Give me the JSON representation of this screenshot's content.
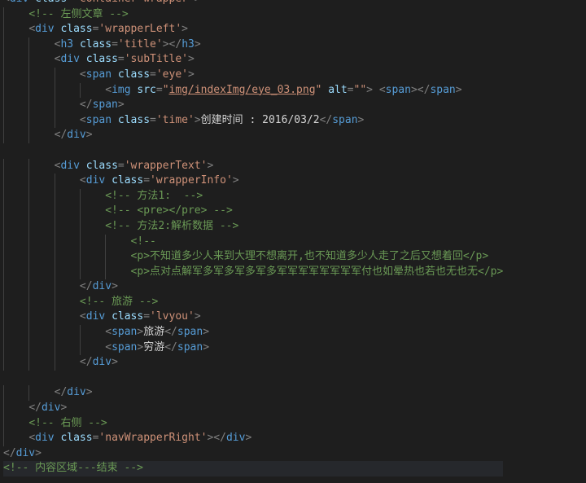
{
  "lines": [
    {
      "indent": 0,
      "tokens": [
        [
          "punct",
          "<"
        ],
        [
          "tag",
          "div"
        ],
        [
          "text",
          " "
        ],
        [
          "attr",
          "class"
        ],
        [
          "punct",
          "="
        ],
        [
          "str",
          "\"container wrapper\""
        ],
        [
          "punct",
          ">"
        ]
      ]
    },
    {
      "indent": 1,
      "tokens": [
        [
          "comment",
          "<!-- 左侧文章 -->"
        ]
      ]
    },
    {
      "indent": 1,
      "tokens": [
        [
          "punct",
          "<"
        ],
        [
          "tag",
          "div"
        ],
        [
          "text",
          " "
        ],
        [
          "attr",
          "class"
        ],
        [
          "punct",
          "="
        ],
        [
          "str",
          "'wrapperLeft'"
        ],
        [
          "punct",
          ">"
        ]
      ]
    },
    {
      "indent": 2,
      "tokens": [
        [
          "punct",
          "<"
        ],
        [
          "tag",
          "h3"
        ],
        [
          "text",
          " "
        ],
        [
          "attr",
          "class"
        ],
        [
          "punct",
          "="
        ],
        [
          "str",
          "'title'"
        ],
        [
          "punct",
          "></"
        ],
        [
          "tag",
          "h3"
        ],
        [
          "punct",
          ">"
        ]
      ]
    },
    {
      "indent": 2,
      "tokens": [
        [
          "punct",
          "<"
        ],
        [
          "tag",
          "div"
        ],
        [
          "text",
          " "
        ],
        [
          "attr",
          "class"
        ],
        [
          "punct",
          "="
        ],
        [
          "str",
          "'subTitle'"
        ],
        [
          "punct",
          ">"
        ]
      ]
    },
    {
      "indent": 3,
      "tokens": [
        [
          "punct",
          "<"
        ],
        [
          "tag",
          "span"
        ],
        [
          "text",
          " "
        ],
        [
          "attr",
          "class"
        ],
        [
          "punct",
          "="
        ],
        [
          "str",
          "'eye'"
        ],
        [
          "punct",
          ">"
        ]
      ]
    },
    {
      "indent": 4,
      "tokens": [
        [
          "punct",
          "<"
        ],
        [
          "tag",
          "img"
        ],
        [
          "text",
          " "
        ],
        [
          "attr",
          "src"
        ],
        [
          "punct",
          "="
        ],
        [
          "str",
          "\""
        ],
        [
          "link",
          "img/indexImg/eye_03.png"
        ],
        [
          "str",
          "\""
        ],
        [
          "text",
          " "
        ],
        [
          "attr",
          "alt"
        ],
        [
          "punct",
          "="
        ],
        [
          "str",
          "\"\""
        ],
        [
          "punct",
          ">"
        ],
        [
          "text",
          " "
        ],
        [
          "punct",
          "<"
        ],
        [
          "tag",
          "span"
        ],
        [
          "punct",
          "></"
        ],
        [
          "tag",
          "span"
        ],
        [
          "punct",
          ">"
        ]
      ]
    },
    {
      "indent": 3,
      "tokens": [
        [
          "punct",
          "</"
        ],
        [
          "tag",
          "span"
        ],
        [
          "punct",
          ">"
        ]
      ]
    },
    {
      "indent": 3,
      "tokens": [
        [
          "punct",
          "<"
        ],
        [
          "tag",
          "span"
        ],
        [
          "text",
          " "
        ],
        [
          "attr",
          "class"
        ],
        [
          "punct",
          "="
        ],
        [
          "str",
          "'time'"
        ],
        [
          "punct",
          ">"
        ],
        [
          "text",
          "创建时间 : 2016/03/2"
        ],
        [
          "punct",
          "</"
        ],
        [
          "tag",
          "span"
        ],
        [
          "punct",
          ">"
        ]
      ]
    },
    {
      "indent": 2,
      "tokens": [
        [
          "punct",
          "</"
        ],
        [
          "tag",
          "div"
        ],
        [
          "punct",
          ">"
        ]
      ]
    },
    {
      "indent": 0,
      "tokens": []
    },
    {
      "indent": 2,
      "tokens": [
        [
          "punct",
          "<"
        ],
        [
          "tag",
          "div"
        ],
        [
          "text",
          " "
        ],
        [
          "attr",
          "class"
        ],
        [
          "punct",
          "="
        ],
        [
          "str",
          "'wrapperText'"
        ],
        [
          "punct",
          ">"
        ]
      ]
    },
    {
      "indent": 3,
      "tokens": [
        [
          "punct",
          "<"
        ],
        [
          "tag",
          "div"
        ],
        [
          "text",
          " "
        ],
        [
          "attr",
          "class"
        ],
        [
          "punct",
          "="
        ],
        [
          "str",
          "'wrapperInfo'"
        ],
        [
          "punct",
          ">"
        ]
      ]
    },
    {
      "indent": 4,
      "tokens": [
        [
          "comment",
          "<!-- 方法1:  -->"
        ]
      ]
    },
    {
      "indent": 4,
      "tokens": [
        [
          "comment",
          "<!-- <pre></pre> -->"
        ]
      ]
    },
    {
      "indent": 4,
      "tokens": [
        [
          "comment",
          "<!-- 方法2:解析数据 -->"
        ]
      ]
    },
    {
      "indent": 5,
      "tokens": [
        [
          "comment",
          "<!--"
        ]
      ]
    },
    {
      "indent": 5,
      "tokens": [
        [
          "comment",
          "<p>不知道多少人来到大理不想离开,也不知道多少人走了之后又想着回</p>"
        ]
      ]
    },
    {
      "indent": 5,
      "tokens": [
        [
          "comment",
          "<p>点对点解军多军多军多军多军军军军军军军军付也如晕热也若也无也无</p>"
        ]
      ]
    },
    {
      "indent": 3,
      "tokens": [
        [
          "punct",
          "</"
        ],
        [
          "tag",
          "div"
        ],
        [
          "punct",
          ">"
        ]
      ]
    },
    {
      "indent": 3,
      "tokens": [
        [
          "comment",
          "<!-- 旅游 -->"
        ]
      ]
    },
    {
      "indent": 3,
      "tokens": [
        [
          "punct",
          "<"
        ],
        [
          "tag",
          "div"
        ],
        [
          "text",
          " "
        ],
        [
          "attr",
          "class"
        ],
        [
          "punct",
          "="
        ],
        [
          "str",
          "'lvyou'"
        ],
        [
          "punct",
          ">"
        ]
      ]
    },
    {
      "indent": 4,
      "tokens": [
        [
          "punct",
          "<"
        ],
        [
          "tag",
          "span"
        ],
        [
          "punct",
          ">"
        ],
        [
          "text",
          "旅游"
        ],
        [
          "punct",
          "</"
        ],
        [
          "tag",
          "span"
        ],
        [
          "punct",
          ">"
        ]
      ]
    },
    {
      "indent": 4,
      "tokens": [
        [
          "punct",
          "<"
        ],
        [
          "tag",
          "span"
        ],
        [
          "punct",
          ">"
        ],
        [
          "text",
          "穷游"
        ],
        [
          "punct",
          "</"
        ],
        [
          "tag",
          "span"
        ],
        [
          "punct",
          ">"
        ]
      ]
    },
    {
      "indent": 3,
      "tokens": [
        [
          "punct",
          "</"
        ],
        [
          "tag",
          "div"
        ],
        [
          "punct",
          ">"
        ]
      ]
    },
    {
      "indent": 0,
      "tokens": []
    },
    {
      "indent": 2,
      "tokens": [
        [
          "punct",
          "</"
        ],
        [
          "tag",
          "div"
        ],
        [
          "punct",
          ">"
        ]
      ]
    },
    {
      "indent": 1,
      "tokens": [
        [
          "punct",
          "</"
        ],
        [
          "tag",
          "div"
        ],
        [
          "punct",
          ">"
        ]
      ]
    },
    {
      "indent": 1,
      "tokens": [
        [
          "comment",
          "<!-- 右侧 -->"
        ]
      ]
    },
    {
      "indent": 1,
      "tokens": [
        [
          "punct",
          "<"
        ],
        [
          "tag",
          "div"
        ],
        [
          "text",
          " "
        ],
        [
          "attr",
          "class"
        ],
        [
          "punct",
          "="
        ],
        [
          "str",
          "'navWrapperRight'"
        ],
        [
          "punct",
          "></"
        ],
        [
          "tag",
          "div"
        ],
        [
          "punct",
          ">"
        ]
      ]
    },
    {
      "indent": 0,
      "tokens": [
        [
          "punct",
          "</"
        ],
        [
          "tag",
          "div"
        ],
        [
          "punct",
          ">"
        ]
      ]
    },
    {
      "indent": 0,
      "tokens": [
        [
          "comment",
          "<!-- 内容区域---结束 -->"
        ]
      ],
      "highlight": true
    }
  ]
}
